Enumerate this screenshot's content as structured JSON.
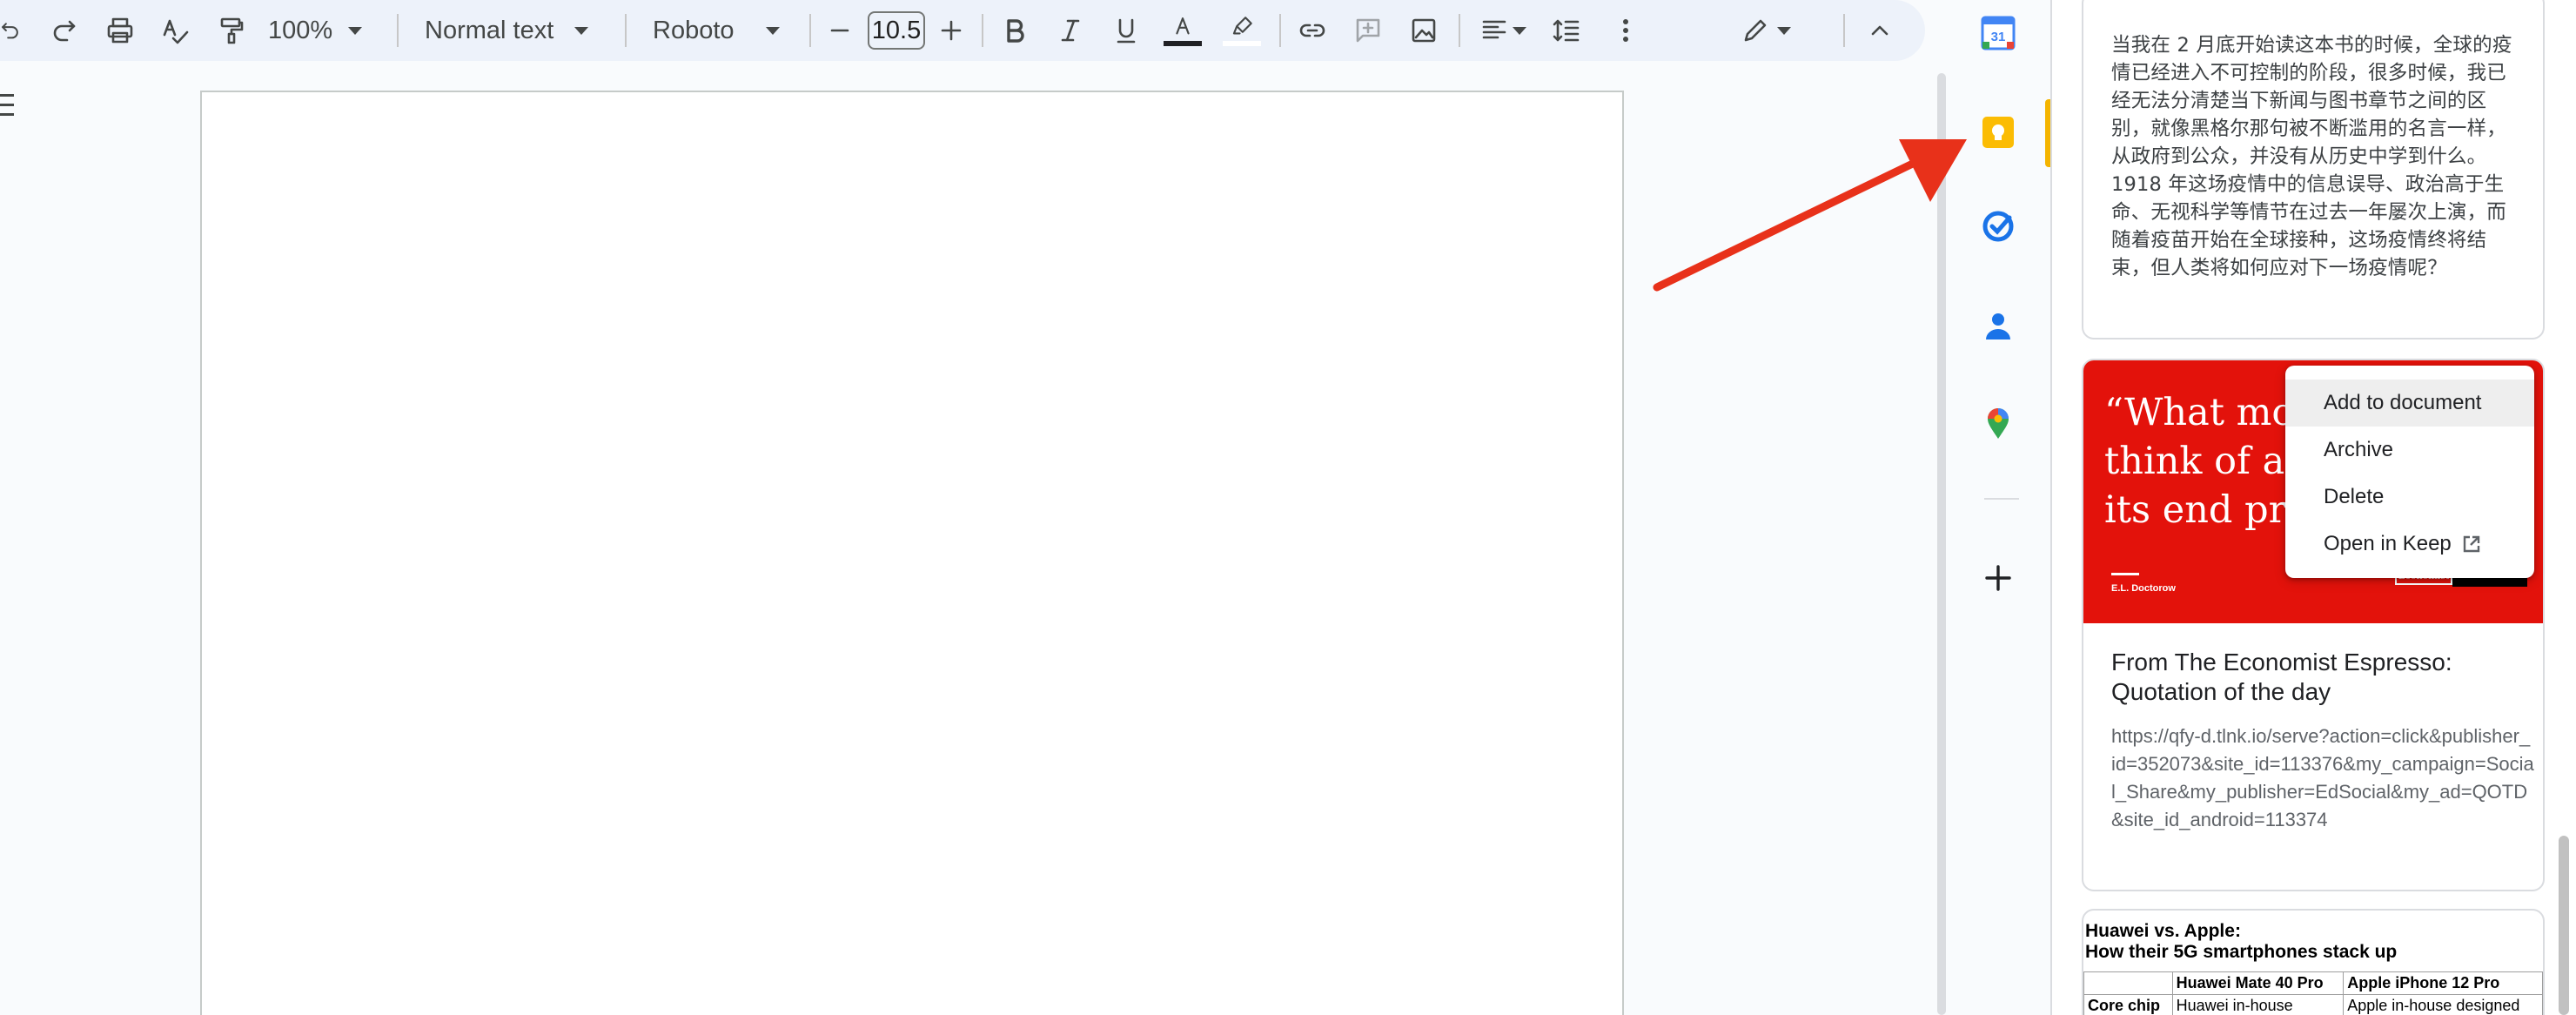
{
  "toolbar": {
    "zoom": "100%",
    "style": "Normal text",
    "font": "Roboto",
    "font_size": "10.5",
    "icons": [
      "undo-icon",
      "redo-icon",
      "print-icon",
      "spellcheck-icon",
      "paint-format-icon",
      "decrease-font-icon",
      "increase-font-icon",
      "bold-icon",
      "italic-icon",
      "underline-icon",
      "text-color-icon",
      "highlight-icon",
      "link-icon",
      "comment-icon",
      "image-icon",
      "align-icon",
      "line-spacing-icon",
      "more-icon",
      "editing-mode-icon",
      "collapse-icon"
    ]
  },
  "rail": {
    "apps": [
      "calendar-icon",
      "keep-icon",
      "tasks-icon",
      "contacts-icon",
      "maps-icon",
      "add-icon"
    ],
    "calendar_day": "31",
    "active_color": "#f4b400"
  },
  "keep": {
    "note1": {
      "body": "当我在 2 月底开始读这本书的时候，全球的疫情已经进入不可控制的阶段，很多时候，我已经无法分清楚当下新闻与图书章节之间的区别，就像黑格尔那句被不断滥用的名言一样，从政府到公众，并没有从历史中学到什么。1918 年这场疫情中的信息误导、政治高于生命、无视科学等情节在过去一年屡次上演，而随着疫苗开始在全球接种，这场疫情终将结束，但人类将如何应对下一场疫情呢？"
    },
    "note2": {
      "image_quote": "“What mos\nthink of as\nits end pro",
      "image_author": "E.L. Doctorow",
      "image_logo": "Economist",
      "title": "From The Economist Espresso: Quotation of the day",
      "body": "https://qfy-d.tlnk.io/serve?action=click&publisher_id=352073&site_id=113376&my_campaign=Social_Share&my_publisher=EdSocial&my_ad=QOTD&site_id_android=113374",
      "image_color": "#e3120b"
    },
    "note3": {
      "title": "Huawei vs. Apple:\nHow their 5G smartphones stack up",
      "table": {
        "headers": [
          "",
          "Huawei Mate 40 Pro",
          "Apple iPhone 12 Pro"
        ],
        "rows": [
          [
            "Core chip",
            "Huawei in-house",
            "Apple in-house designed"
          ]
        ]
      }
    }
  },
  "menu": {
    "items": [
      "Add to document",
      "Archive",
      "Delete",
      "Open in Keep"
    ]
  },
  "colors": {
    "annotation_arrow": "#e8311a"
  }
}
